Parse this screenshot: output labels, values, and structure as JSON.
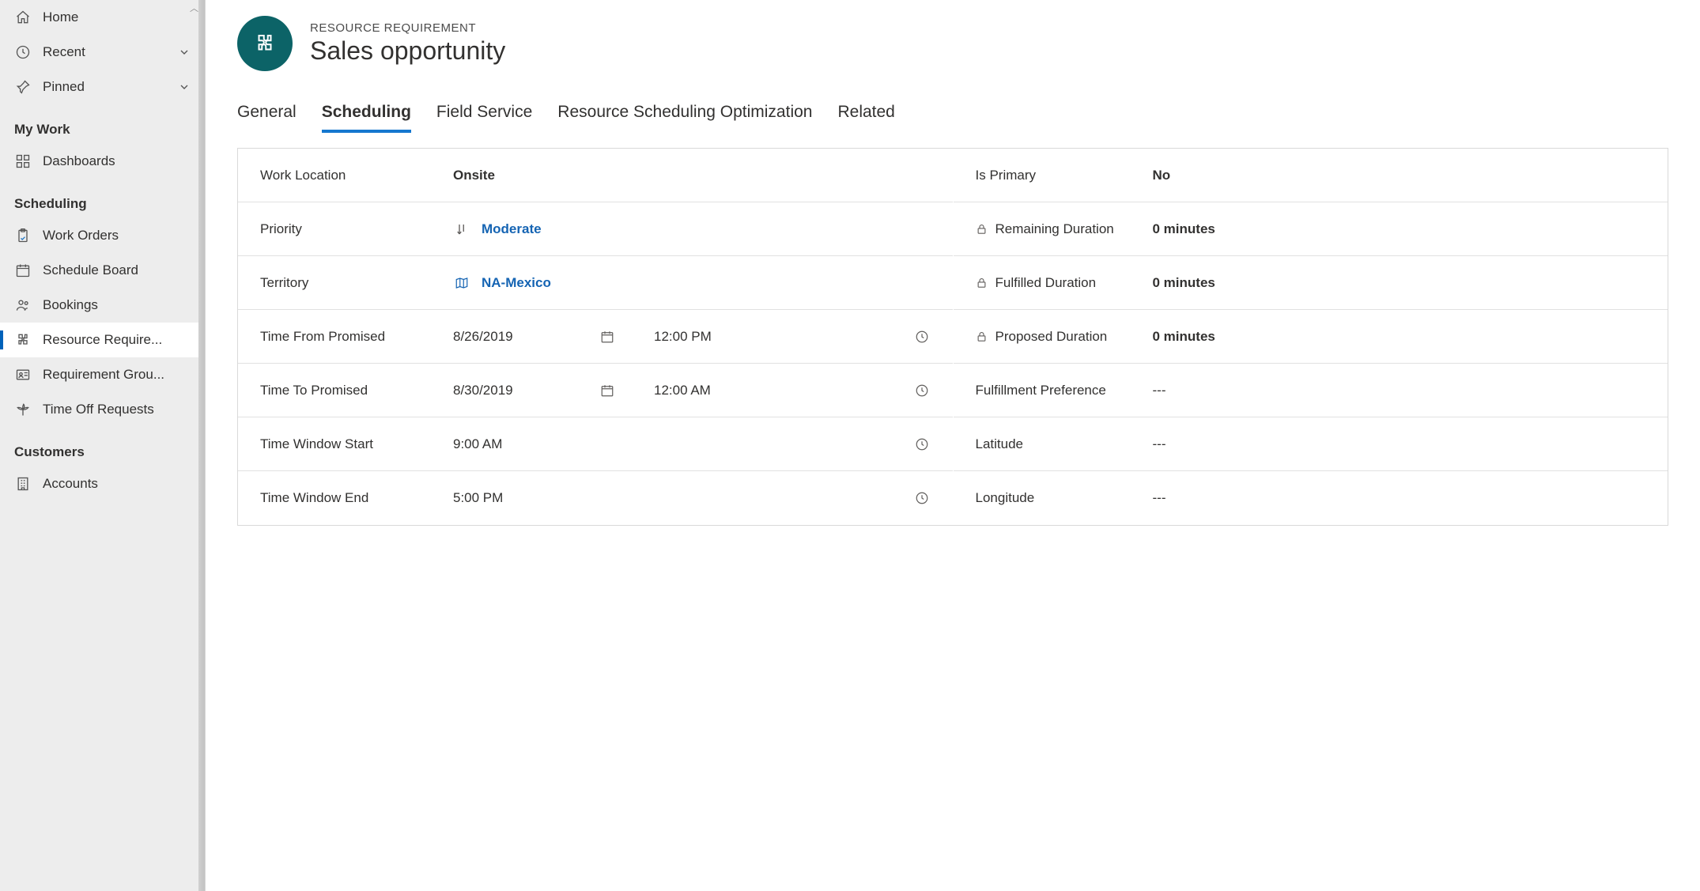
{
  "sidebar": {
    "top": [
      {
        "icon": "home",
        "label": "Home"
      },
      {
        "icon": "clock",
        "label": "Recent",
        "expandable": true
      },
      {
        "icon": "pin",
        "label": "Pinned",
        "expandable": true
      }
    ],
    "sections": [
      {
        "title": "My Work",
        "items": [
          {
            "icon": "grid",
            "label": "Dashboards"
          }
        ]
      },
      {
        "title": "Scheduling",
        "items": [
          {
            "icon": "clipboard",
            "label": "Work Orders"
          },
          {
            "icon": "calendar",
            "label": "Schedule Board"
          },
          {
            "icon": "people",
            "label": "Bookings"
          },
          {
            "icon": "puzzle",
            "label": "Resource Require...",
            "selected": true
          },
          {
            "icon": "idcard",
            "label": "Requirement Grou..."
          },
          {
            "icon": "palm",
            "label": "Time Off Requests"
          }
        ]
      },
      {
        "title": "Customers",
        "items": [
          {
            "icon": "building",
            "label": "Accounts"
          }
        ]
      }
    ]
  },
  "header": {
    "eyebrow": "RESOURCE REQUIREMENT",
    "title": "Sales opportunity"
  },
  "tabs": [
    {
      "label": "General"
    },
    {
      "label": "Scheduling",
      "active": true
    },
    {
      "label": "Field Service"
    },
    {
      "label": "Resource Scheduling Optimization"
    },
    {
      "label": "Related"
    }
  ],
  "left_fields": {
    "work_location": {
      "label": "Work Location",
      "value": "Onsite"
    },
    "priority": {
      "label": "Priority",
      "value": "Moderate"
    },
    "territory": {
      "label": "Territory",
      "value": "NA-Mexico"
    },
    "time_from": {
      "label": "Time From Promised",
      "date": "8/26/2019",
      "time": "12:00 PM"
    },
    "time_to": {
      "label": "Time To Promised",
      "date": "8/30/2019",
      "time": "12:00 AM"
    },
    "window_start": {
      "label": "Time Window Start",
      "time": "9:00 AM"
    },
    "window_end": {
      "label": "Time Window End",
      "time": "5:00 PM"
    }
  },
  "right_fields": {
    "is_primary": {
      "label": "Is Primary",
      "value": "No"
    },
    "remaining": {
      "label": "Remaining Duration",
      "value": "0 minutes",
      "locked": true
    },
    "fulfilled": {
      "label": "Fulfilled Duration",
      "value": "0 minutes",
      "locked": true
    },
    "proposed": {
      "label": "Proposed Duration",
      "value": "0 minutes",
      "locked": true
    },
    "pref": {
      "label": "Fulfillment Preference",
      "value": "---"
    },
    "lat": {
      "label": "Latitude",
      "value": "---"
    },
    "lon": {
      "label": "Longitude",
      "value": "---"
    }
  }
}
